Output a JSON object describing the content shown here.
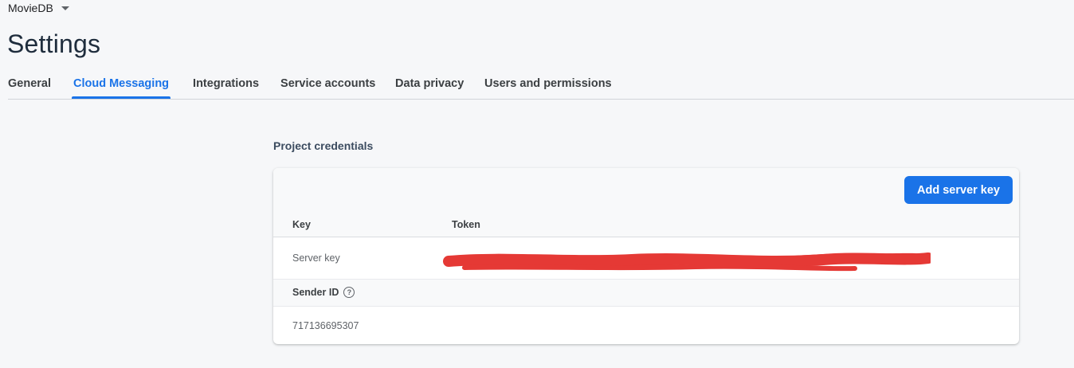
{
  "project": {
    "name": "MovieDB"
  },
  "page": {
    "title": "Settings"
  },
  "tabs": [
    {
      "label": "General",
      "active": false
    },
    {
      "label": "Cloud Messaging",
      "active": true
    },
    {
      "label": "Integrations",
      "active": false
    },
    {
      "label": "Service accounts",
      "active": false
    },
    {
      "label": "Data privacy",
      "active": false
    },
    {
      "label": "Users and permissions",
      "active": false
    }
  ],
  "credentials": {
    "section_title": "Project credentials",
    "add_button_label": "Add server key",
    "columns": {
      "key": "Key",
      "token": "Token"
    },
    "server_key": {
      "label": "Server key",
      "token_redacted": true
    },
    "sender": {
      "label": "Sender ID",
      "help_icon": "help-circle-icon",
      "value": "717136695307"
    }
  },
  "colors": {
    "accent": "#1a73e8",
    "redaction": "#e53935"
  }
}
